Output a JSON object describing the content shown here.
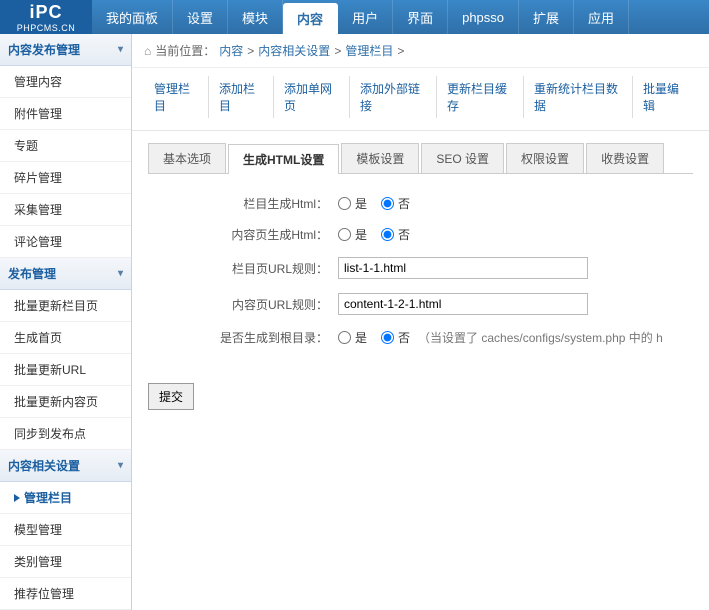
{
  "logo": {
    "top": "iPC",
    "sub": "PHPCMS.CN"
  },
  "topnav": [
    {
      "label": "我的面板"
    },
    {
      "label": "设置"
    },
    {
      "label": "模块"
    },
    {
      "label": "内容",
      "active": true
    },
    {
      "label": "用户"
    },
    {
      "label": "界面"
    },
    {
      "label": "phpsso"
    },
    {
      "label": "扩展"
    },
    {
      "label": "应用"
    }
  ],
  "sidebar": {
    "groups": [
      {
        "title": "内容发布管理",
        "items": [
          {
            "label": "管理内容"
          },
          {
            "label": "附件管理"
          },
          {
            "label": "专题"
          },
          {
            "label": "碎片管理"
          },
          {
            "label": "采集管理"
          },
          {
            "label": "评论管理"
          }
        ]
      },
      {
        "title": "发布管理",
        "items": [
          {
            "label": "批量更新栏目页"
          },
          {
            "label": "生成首页"
          },
          {
            "label": "批量更新URL"
          },
          {
            "label": "批量更新内容页"
          },
          {
            "label": "同步到发布点"
          }
        ]
      },
      {
        "title": "内容相关设置",
        "items": [
          {
            "label": "管理栏目",
            "active": true
          },
          {
            "label": "模型管理"
          },
          {
            "label": "类别管理"
          },
          {
            "label": "推荐位管理"
          }
        ]
      }
    ]
  },
  "breadcrumb": {
    "home_icon": "⌂",
    "prefix": "当前位置：",
    "parts": [
      "内容",
      "内容相关设置",
      "管理栏目"
    ],
    "sep": ">"
  },
  "subnav": [
    {
      "label": "管理栏目"
    },
    {
      "label": "添加栏目"
    },
    {
      "label": "添加单网页"
    },
    {
      "label": "添加外部链接"
    },
    {
      "label": "更新栏目缓存"
    },
    {
      "label": "重新统计栏目数据"
    },
    {
      "label": "批量编辑"
    }
  ],
  "tabs": [
    {
      "label": "基本选项"
    },
    {
      "label": "生成HTML设置",
      "active": true
    },
    {
      "label": "模板设置"
    },
    {
      "label": "SEO 设置"
    },
    {
      "label": "权限设置"
    },
    {
      "label": "收费设置"
    }
  ],
  "form": {
    "yes": "是",
    "no": "否",
    "rows": {
      "col_html": {
        "label": "栏目生成Html：",
        "value": "no"
      },
      "content_html": {
        "label": "内容页生成Html：",
        "value": "no"
      },
      "col_url_rule": {
        "label": "栏目页URL规则：",
        "value": "list-1-1.html"
      },
      "content_url_rule": {
        "label": "内容页URL规则：",
        "value": "content-1-2-1.html"
      },
      "gen_root": {
        "label": "是否生成到根目录：",
        "value": "no",
        "note": "（当设置了 caches/configs/system.php 中的 h"
      }
    }
  },
  "submit_label": "提交"
}
